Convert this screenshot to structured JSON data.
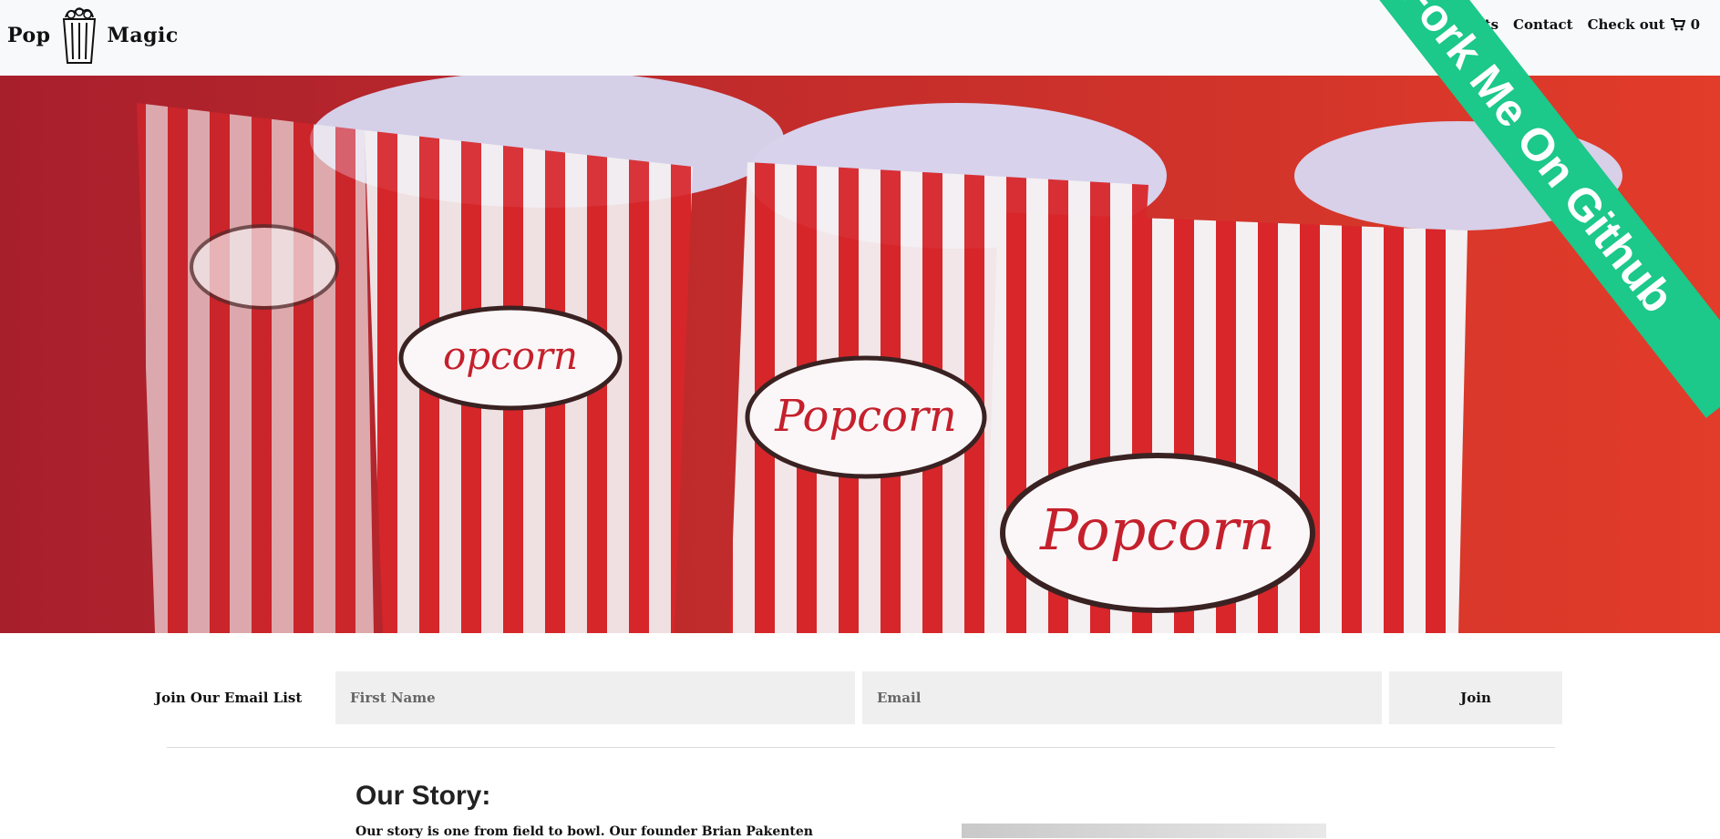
{
  "brand": {
    "word_left": "Pop",
    "word_right": "Magic",
    "logo_icon": "popcorn-box-icon"
  },
  "nav": {
    "items": [
      {
        "label": "t"
      },
      {
        "label": "Products"
      },
      {
        "label": "Contact"
      },
      {
        "label": "Check out"
      }
    ],
    "cart_icon": "cart-icon",
    "cart_count": "0"
  },
  "hero": {
    "image_subject": "popcorn-bags-photo"
  },
  "ribbon": {
    "label": "Fork Me On Github",
    "color": "#1cc88a"
  },
  "email_form": {
    "label": "Join Our Email List",
    "first_name_placeholder": "First Name",
    "email_placeholder": "Email",
    "join_label": "Join"
  },
  "story": {
    "title": "Our Story:",
    "text": "Our story is one from field to bowl. Our founder Brian Pakenten"
  }
}
